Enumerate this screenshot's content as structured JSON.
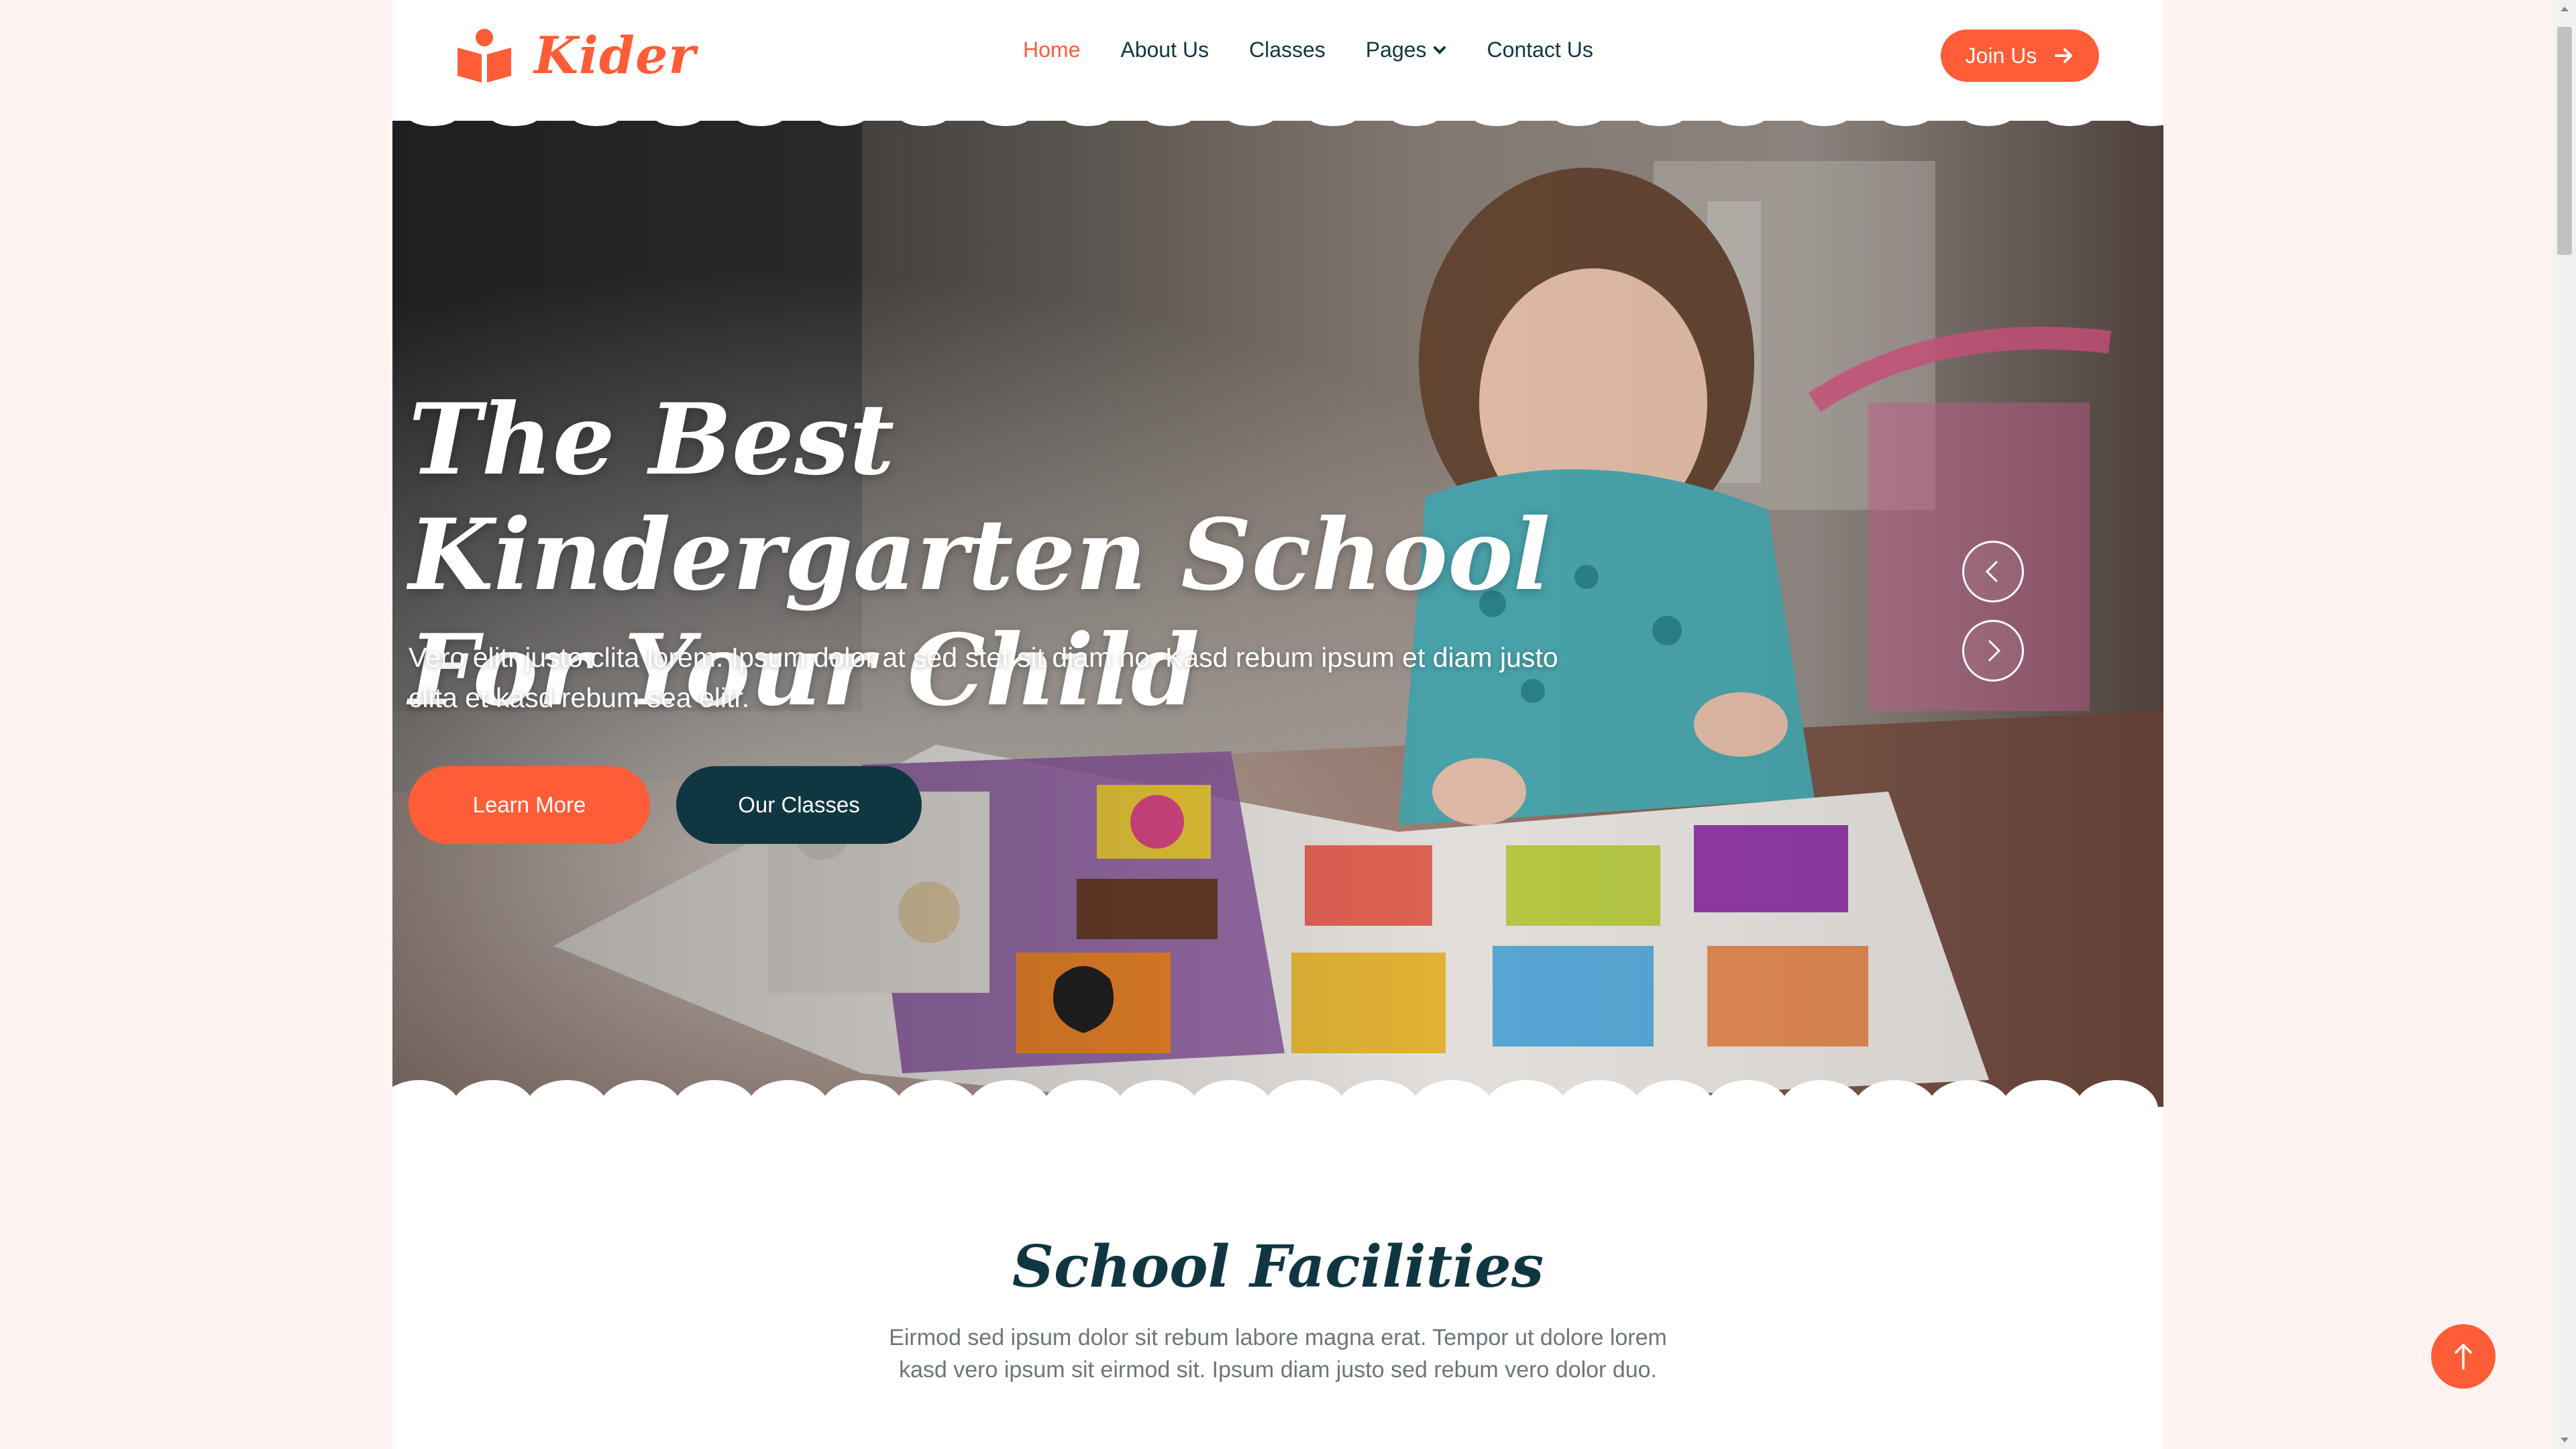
{
  "brand": {
    "name": "Kider",
    "accent": "#fe5d37",
    "dark": "#103741"
  },
  "nav": {
    "items": [
      {
        "label": "Home",
        "active": true
      },
      {
        "label": "About Us"
      },
      {
        "label": "Classes"
      },
      {
        "label": "Pages",
        "dropdown": true
      },
      {
        "label": "Contact Us"
      }
    ],
    "join_label": "Join Us"
  },
  "hero": {
    "title_line1": "The Best Kindergarten School",
    "title_line2": "For Your Child",
    "description": "Vero elitr justo clita lorem. Ipsum dolor at sed stet sit diam no. Kasd rebum ipsum et diam justo clita et kasd rebum sea elitr.",
    "learn_more_label": "Learn More",
    "our_classes_label": "Our Classes",
    "carousel_icons": [
      "chevron-left-icon",
      "chevron-right-icon"
    ]
  },
  "facilities": {
    "title": "School Facilities",
    "description": "Eirmod sed ipsum dolor sit rebum labore magna erat. Tempor ut dolore lorem kasd vero ipsum sit eirmod sit. Ipsum diam justo sed rebum vero dolor duo."
  },
  "back_to_top_icon": "arrow-up-icon"
}
